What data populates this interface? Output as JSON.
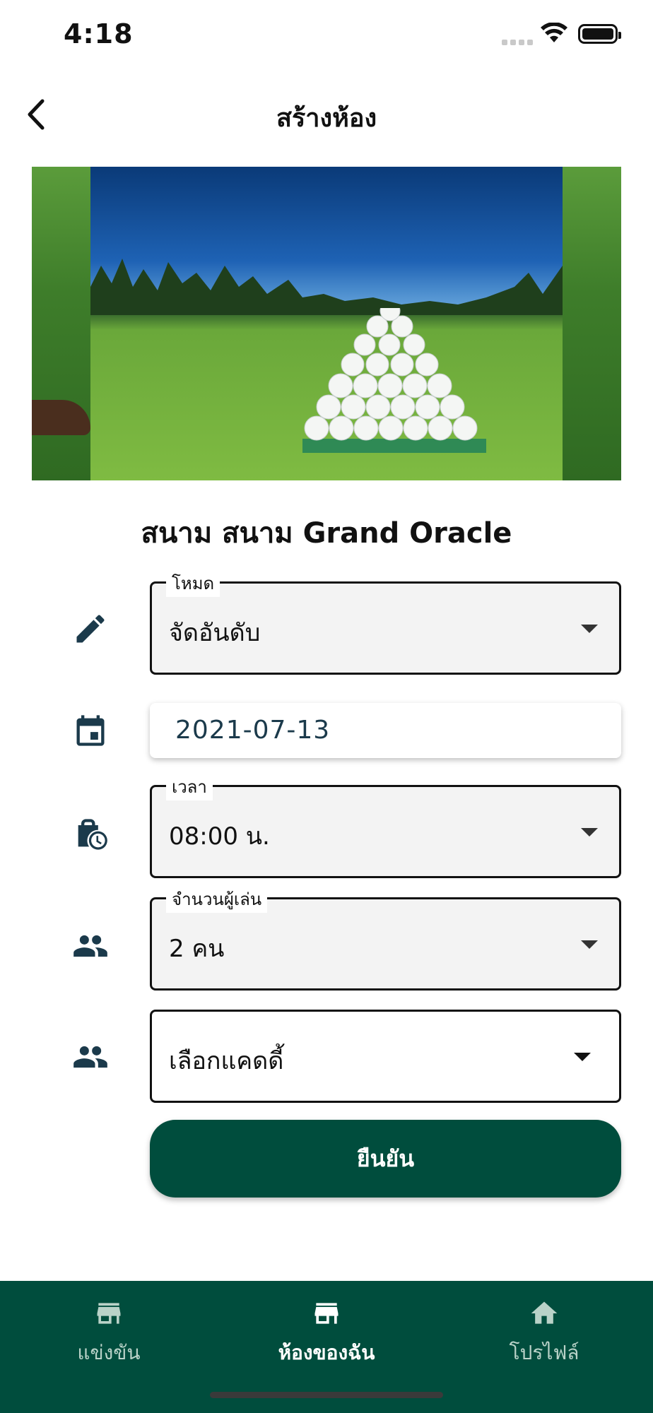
{
  "status_bar": {
    "time": "4:18"
  },
  "header": {
    "title": "สร้างห้อง"
  },
  "course": {
    "name": "สนาม สนาม Grand Oracle"
  },
  "form": {
    "mode": {
      "label": "โหมด",
      "value": "จัดอันดับ"
    },
    "date": {
      "value": "2021-07-13"
    },
    "time": {
      "label": "เวลา",
      "value": "08:00 น."
    },
    "players": {
      "label": "จำนวนผู้เล่น",
      "value": "2 คน"
    },
    "caddy": {
      "value": "เลือกแคดดี้"
    },
    "confirm_label": "ยืนยัน"
  },
  "bottom_nav": {
    "items": [
      {
        "label": "แข่งขัน",
        "icon": "store-icon",
        "active": false
      },
      {
        "label": "ห้องของฉัน",
        "icon": "store-icon",
        "active": true
      },
      {
        "label": "โปรไฟล์",
        "icon": "home-icon",
        "active": false
      }
    ]
  },
  "colors": {
    "primary": "#004d3d",
    "icon": "#1b3a4b",
    "field_bg": "#f3f3f3"
  }
}
